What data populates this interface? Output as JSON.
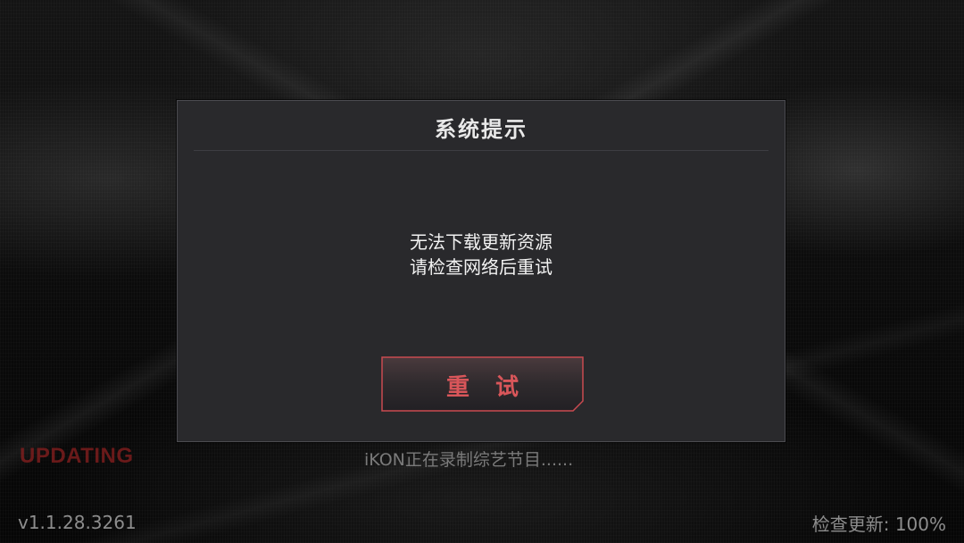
{
  "status": {
    "updating_label": "UPDATING",
    "tip_text": "iKON正在录制综艺节目......",
    "version": "v1.1.28.3261",
    "check_update_label": "检查更新: 100%",
    "check_update_progress": 100
  },
  "dialog": {
    "title": "系统提示",
    "message_lines": [
      "无法下载更新资源",
      "请检查网络后重试"
    ],
    "retry_label": "重 试"
  },
  "colors": {
    "accent": "#d9565a",
    "dialog_bg": "#29292c",
    "updating": "#8a1f1f"
  }
}
